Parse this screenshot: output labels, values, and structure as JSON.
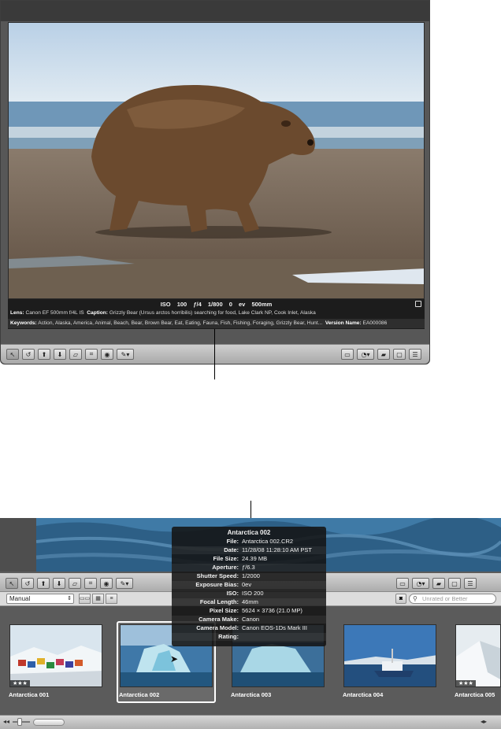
{
  "viewer": {
    "exif": {
      "iso": "ISO 100",
      "aperture": "ƒ/4",
      "shutter": "1/800",
      "ev": "0 ev",
      "focal": "500mm"
    },
    "lens_label": "Lens:",
    "lens_value": "Canon EF 500mm f/4L IS",
    "caption_label": "Caption:",
    "caption_value": "Grizzly Bear (Ursus arctos horribilis) searching for food, Lake Clark NP, Cook Inlet, Alaska",
    "keywords_label": "Keywords:",
    "keywords_value": "Action, Alaska, America, Animal, Beach, Bear, Brown Bear, Eat, Eating, Fauna, Fish, Fishing, Foraging, Grizzly Bear, Hunt...",
    "version_label": "Version Name:",
    "version_value": "EA000086",
    "toolbar_left_icons": [
      "pointer-icon",
      "rotate-icon",
      "lift-icon",
      "stamp-icon",
      "straighten-icon",
      "crop-icon",
      "red-eye-icon",
      "brush-icon"
    ],
    "toolbar_right_icons": [
      "hud-icon",
      "loupe-icon",
      "flag-icon",
      "full-screen-icon",
      "browser-icon"
    ]
  },
  "browser": {
    "sort_value": "Manual",
    "search_placeholder": "Unrated or Better",
    "hud": {
      "title": "Antarctica 002",
      "rows": [
        {
          "k": "File:",
          "v": "Antarctica 002.CR2"
        },
        {
          "k": "Date:",
          "v": "11/28/08 11:28:10 AM PST"
        },
        {
          "k": "File Size:",
          "v": "24.39 MB"
        },
        {
          "k": "Aperture:",
          "v": "ƒ/6.3"
        },
        {
          "k": "Shutter Speed:",
          "v": "1/2000"
        },
        {
          "k": "Exposure Bias:",
          "v": "0ev"
        },
        {
          "k": "ISO:",
          "v": "ISO 200"
        },
        {
          "k": "Focal Length:",
          "v": "46mm"
        },
        {
          "k": "Pixel Size:",
          "v": "5624 × 3736 (21.0 MP)"
        },
        {
          "k": "Camera Make:",
          "v": "Canon"
        },
        {
          "k": "Camera Model:",
          "v": "Canon EOS-1Ds Mark III"
        },
        {
          "k": "Rating:",
          "v": ""
        }
      ]
    },
    "thumbnails": [
      {
        "label": "Antarctica 001",
        "stars": "★★★"
      },
      {
        "label": "Antarctica 002",
        "stars": ""
      },
      {
        "label": "Antarctica 003",
        "stars": ""
      },
      {
        "label": "Antarctica 004",
        "stars": ""
      },
      {
        "label": "Antarctica 005",
        "stars": "★★★"
      }
    ]
  },
  "colors": {
    "panel_dark": "#1c1c1c",
    "window_gray": "#575757",
    "selection_border": "#ffffff"
  }
}
